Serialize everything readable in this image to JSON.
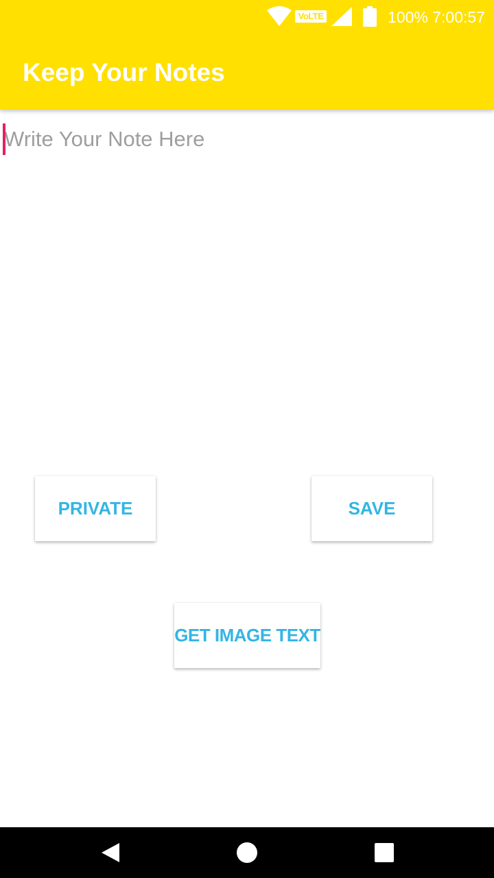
{
  "status_bar": {
    "battery_text": "100%",
    "time": "7:00:57",
    "network_badge": "VoLTE",
    "icons": [
      "wifi-icon",
      "volte-icon",
      "signal-icon",
      "battery-icon"
    ]
  },
  "header": {
    "title": "Keep Your Notes",
    "background_color": "#ffe000"
  },
  "editor": {
    "placeholder": "Write Your Note Here",
    "value": "",
    "cursor_color": "#e91e63"
  },
  "buttons": {
    "private_label": "PRIVATE",
    "save_label": "SAVE",
    "image_text_label": "GET IMAGE TEXT",
    "text_color": "#33b5e5"
  },
  "nav_bar": {
    "icons": [
      "back-icon",
      "home-icon",
      "recents-icon"
    ]
  }
}
